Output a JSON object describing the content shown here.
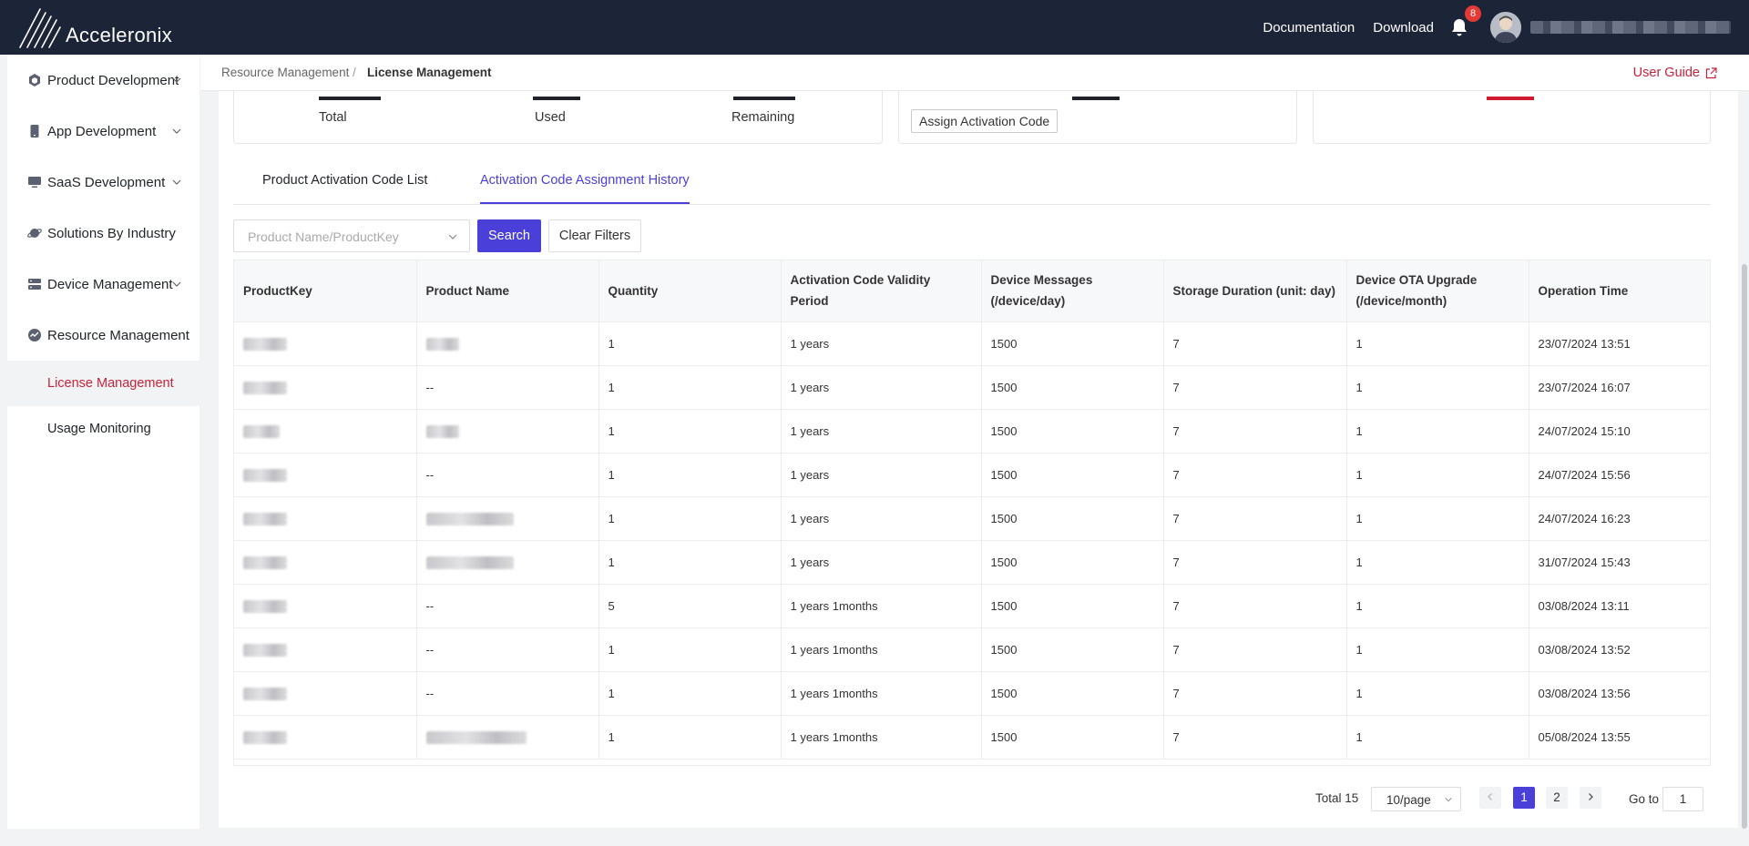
{
  "brand": {
    "name": "Acceleronix"
  },
  "topnav": {
    "documentation": "Documentation",
    "download": "Download",
    "notifications": "8",
    "user_name": ""
  },
  "sidebar": {
    "items": [
      {
        "label": "Product Development",
        "icon": "cube-icon",
        "has_children": true
      },
      {
        "label": "App Development",
        "icon": "phone-icon",
        "has_children": true
      },
      {
        "label": "SaaS Development",
        "icon": "monitor-icon",
        "has_children": true
      },
      {
        "label": "Solutions By Industry",
        "icon": "planet-icon",
        "has_children": false
      },
      {
        "label": "Device Management",
        "icon": "server-icon",
        "has_children": true
      },
      {
        "label": "Resource Management",
        "icon": "gauge-icon",
        "has_children": false
      }
    ],
    "sub_items": [
      {
        "label": "License Management",
        "active": true
      },
      {
        "label": "Usage Monitoring",
        "active": false
      }
    ]
  },
  "breadcrumb": {
    "parent": "Resource Management",
    "separator": "/",
    "current": "License Management"
  },
  "user_guide": "User Guide",
  "stats": {
    "total_label": "Total",
    "used_label": "Used",
    "remaining_label": "Remaining",
    "assign_button": "Assign Activation Code"
  },
  "tabs": [
    {
      "label": "Product Activation Code List",
      "active": false
    },
    {
      "label": "Activation Code Assignment History",
      "active": true
    }
  ],
  "filter": {
    "placeholder": "Product Name/ProductKey",
    "search": "Search",
    "clear": "Clear Filters"
  },
  "table": {
    "columns": [
      "ProductKey",
      "Product Name",
      "Quantity",
      "Activation Code Validity Period",
      "Device Messages (/device/day)",
      "Storage Duration (unit: day)",
      "Device OTA Upgrade (/device/month)",
      "Operation Time"
    ],
    "rows": [
      {
        "product_name": "",
        "quantity": "1",
        "validity": "1 years",
        "messages": "1500",
        "storage": "7",
        "ota": "1",
        "time": "23/07/2024 13:51"
      },
      {
        "product_name": "--",
        "quantity": "1",
        "validity": "1 years",
        "messages": "1500",
        "storage": "7",
        "ota": "1",
        "time": "23/07/2024 16:07"
      },
      {
        "product_name": "",
        "quantity": "1",
        "validity": "1 years",
        "messages": "1500",
        "storage": "7",
        "ota": "1",
        "time": "24/07/2024 15:10"
      },
      {
        "product_name": "--",
        "quantity": "1",
        "validity": "1 years",
        "messages": "1500",
        "storage": "7",
        "ota": "1",
        "time": "24/07/2024 15:56"
      },
      {
        "product_name": "",
        "quantity": "1",
        "validity": "1 years",
        "messages": "1500",
        "storage": "7",
        "ota": "1",
        "time": "24/07/2024 16:23"
      },
      {
        "product_name": "",
        "quantity": "1",
        "validity": "1 years",
        "messages": "1500",
        "storage": "7",
        "ota": "1",
        "time": "31/07/2024 15:43"
      },
      {
        "product_name": "--",
        "quantity": "5",
        "validity": "1 years 1months",
        "messages": "1500",
        "storage": "7",
        "ota": "1",
        "time": "03/08/2024 13:11"
      },
      {
        "product_name": "--",
        "quantity": "1",
        "validity": "1 years 1months",
        "messages": "1500",
        "storage": "7",
        "ota": "1",
        "time": "03/08/2024 13:52"
      },
      {
        "product_name": "--",
        "quantity": "1",
        "validity": "1 years 1months",
        "messages": "1500",
        "storage": "7",
        "ota": "1",
        "time": "03/08/2024 13:56"
      },
      {
        "product_name": "",
        "quantity": "1",
        "validity": "1 years 1months",
        "messages": "1500",
        "storage": "7",
        "ota": "1",
        "time": "05/08/2024 13:55"
      }
    ]
  },
  "pagination": {
    "total": "Total 15",
    "page_size": "10/page",
    "pages": [
      "1",
      "2"
    ],
    "current": "1",
    "goto_label": "Go to",
    "goto_value": "1"
  },
  "colors": {
    "topbar": "#1c2438",
    "accent": "#4a3fd8",
    "active_link": "#c7223b"
  }
}
